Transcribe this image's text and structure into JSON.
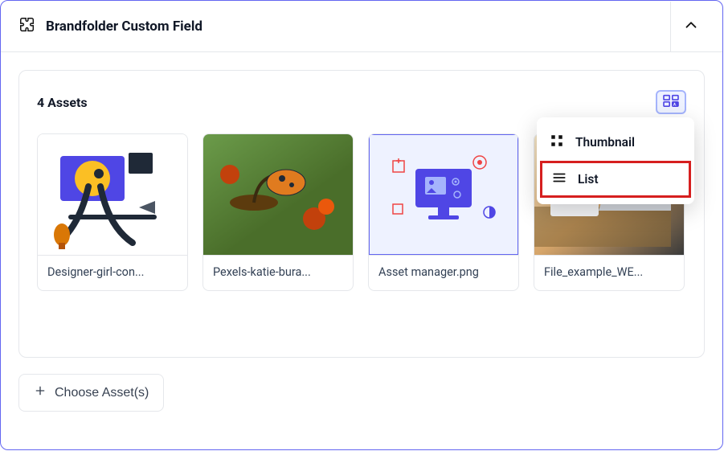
{
  "header": {
    "title": "Brandfolder Custom Field"
  },
  "assets": {
    "count_label": "4 Assets",
    "items": [
      {
        "name": "Designer-girl-con..."
      },
      {
        "name": "Pexels-katie-bura..."
      },
      {
        "name": "Asset manager.png"
      },
      {
        "name": "File_example_WE..."
      }
    ]
  },
  "view_menu": {
    "thumbnail": "Thumbnail",
    "list": "List"
  },
  "choose_label": "Choose Asset(s)"
}
